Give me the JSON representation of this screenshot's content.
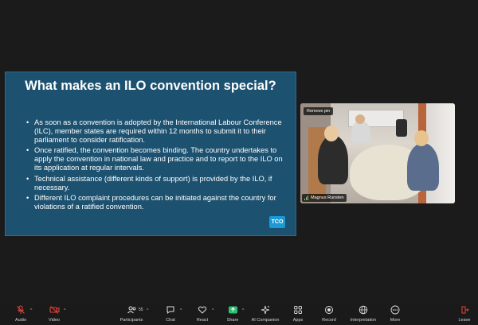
{
  "slide": {
    "title": "What makes an ILO convention special?",
    "bullets": [
      "As soon as a convention is adopted by the International Labour Conference (ILC), member states are required within 12 months to submit it to their parliament to consider ratification.",
      "Once ratified, the convention becomes binding. The country undertakes to apply the convention in national law and practice and to report to the ILO on its application at regular intervals.",
      "Technical assistance (different kinds of support) is provided by the ILO, if necessary.",
      "Different ILO complaint procedures can be initiated against the country for violations of a ratified convention."
    ],
    "logo": "TCO"
  },
  "video": {
    "remove_pin_label": "Remove pin",
    "participant_name": "Magnus Runsten"
  },
  "toolbar": {
    "audio": "Audio",
    "video": "Video",
    "participants": "Participants",
    "participants_count": "55",
    "chat": "Chat",
    "react": "React",
    "share": "Share",
    "ai_companion": "AI Companion",
    "apps": "Apps",
    "record": "Record",
    "interpretation": "Interpretation",
    "more": "More",
    "leave": "Leave"
  },
  "colors": {
    "slide_bg": "#1c5170",
    "share_green": "#2fbf71",
    "leave_red": "#e5423a",
    "muted_red": "#e5423a"
  }
}
